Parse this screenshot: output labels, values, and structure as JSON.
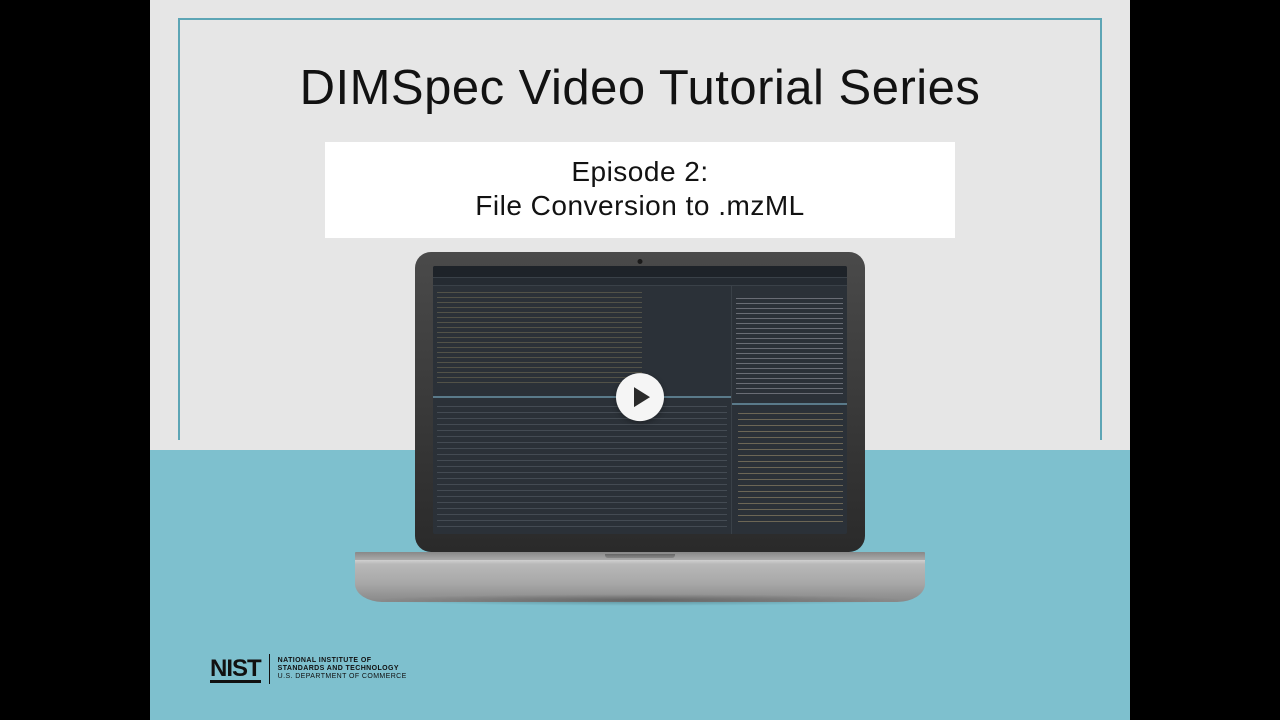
{
  "slide": {
    "title": "DIMSpec Video Tutorial Series",
    "episode_line1": "Episode 2:",
    "episode_line2": "File Conversion to .mzML"
  },
  "logo": {
    "mark": "NIST",
    "line1": "NATIONAL INSTITUTE OF",
    "line2": "STANDARDS AND TECHNOLOGY",
    "line3": "U.S. DEPARTMENT OF COMMERCE"
  },
  "colors": {
    "frame_border": "#5da5b5",
    "bg_top": "#e6e6e6",
    "bg_bottom": "#7ec0ce",
    "pillar": "#000000"
  }
}
